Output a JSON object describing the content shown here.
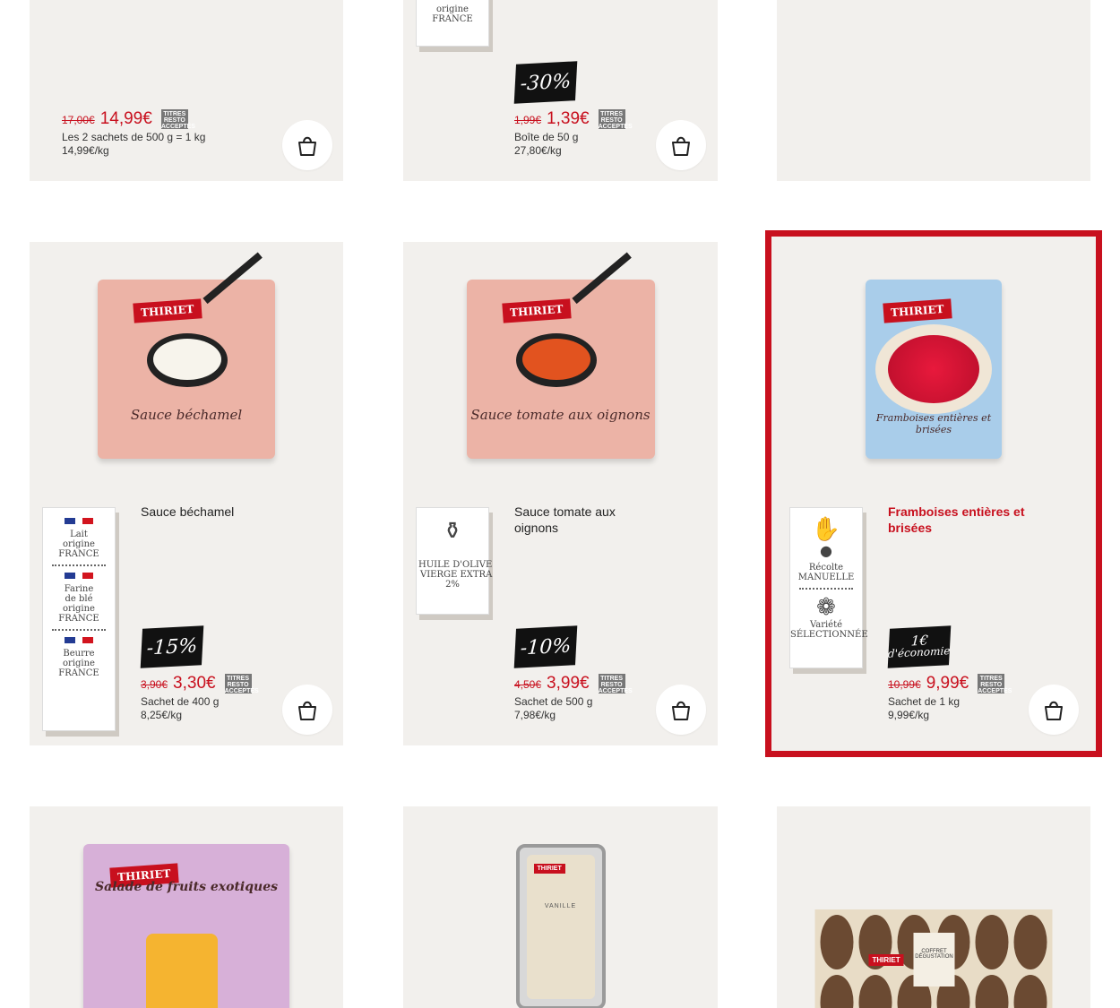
{
  "colors": {
    "accent": "#c8101e",
    "card_bg": "#f2f0ed",
    "page_bg": "#ffffff"
  },
  "icons": {
    "cart": "basket-icon",
    "olive_oil": "olive-oil-bottle-icon",
    "hand": "harvest-hand-icon",
    "berry": "raspberry-icon",
    "flag": "france-flag-icon",
    "resto": "titres-resto-badge"
  },
  "resto_badge": "TITRES RESTO ACCEPTÉS",
  "row1": [
    {
      "old_price": "17,00€",
      "price": "14,99€",
      "size": "Les 2 sachets de 500 g = 1 kg",
      "unit_price": "14,99€/kg"
    },
    {
      "tag_lines": [
        "origine",
        "FRANCE"
      ],
      "promo": "-30%",
      "old_price": "1,99€",
      "price": "1,39€",
      "size": "Boîte de 50 g",
      "unit_price": "27,80€/kg"
    },
    {}
  ],
  "row2": [
    {
      "image_title": "Sauce béchamel",
      "name": "Sauce béchamel",
      "tags": [
        {
          "line1": "Lait",
          "line2": "origine",
          "line3": "FRANCE"
        },
        {
          "line1": "Farine",
          "line2": "de blé",
          "line3": "origine",
          "line4": "FRANCE"
        },
        {
          "line1": "Beurre",
          "line2": "origine",
          "line3": "FRANCE"
        }
      ],
      "promo": "-15%",
      "old_price": "3,90€",
      "price": "3,30€",
      "size": "Sachet de 400 g",
      "unit_price": "8,25€/kg"
    },
    {
      "image_title": "Sauce tomate aux oignons",
      "name": "Sauce tomate aux oignons",
      "tag": {
        "line1": "HUILE D'OLIVE",
        "line2": "VIERGE EXTRA",
        "line3": "2%"
      },
      "promo": "-10%",
      "old_price": "4,50€",
      "price": "3,99€",
      "size": "Sachet de 500 g",
      "unit_price": "7,98€/kg"
    },
    {
      "image_title": "Framboises entières et brisées",
      "name": "Framboises entières et brisées",
      "tags": [
        {
          "line1": "Récolte",
          "line2": "MANUELLE"
        },
        {
          "line1": "Variété",
          "line2": "SÉLECTIONNÉE"
        }
      ],
      "promo_line1": "1€",
      "promo_line2": "d'économie",
      "old_price": "10,99€",
      "price": "9,99€",
      "size": "Sachet de 1 kg",
      "unit_price": "9,99€/kg"
    }
  ],
  "row3": [
    {
      "image_title": "Salade de fruits exotiques"
    },
    {
      "image_title": "VANILLE"
    },
    {
      "image_title": "COFFRET DÉGUSTATION"
    }
  ],
  "brand": "THIRIET"
}
